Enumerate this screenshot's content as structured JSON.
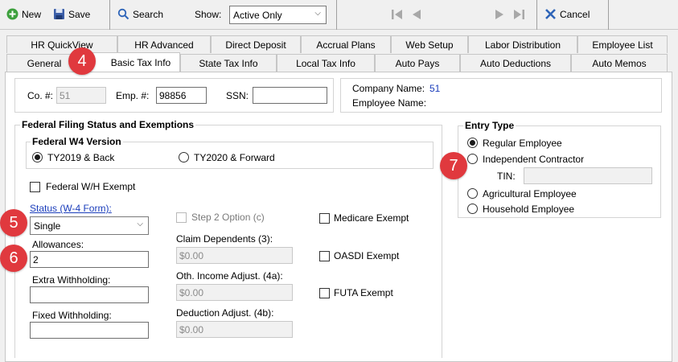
{
  "toolbar": {
    "new_label": "New",
    "save_label": "Save",
    "search_label": "Search",
    "show_label": "Show:",
    "show_value": "Active Only",
    "cancel_label": "Cancel"
  },
  "tabs_row1": [
    "HR QuickView",
    "HR Advanced",
    "Direct Deposit",
    "Accrual Plans",
    "Web Setup",
    "Labor Distribution",
    "Employee List"
  ],
  "tabs_row2": [
    "General",
    "Basic Tax Info",
    "State Tax Info",
    "Local Tax Info",
    "Auto Pays",
    "Auto Deductions",
    "Auto Memos"
  ],
  "header": {
    "co_label": "Co. #:",
    "co_value": "51",
    "emp_label": "Emp. #:",
    "emp_value": "98856",
    "ssn_label": "SSN:",
    "ssn_value": "",
    "company_name_label": "Company Name:",
    "company_name_value": "51",
    "employee_name_label": "Employee Name:",
    "employee_name_value": ""
  },
  "federal": {
    "title": "Federal Filing Status and Exemptions",
    "w4_title": "Federal W4 Version",
    "w4_opt1": "TY2019 & Back",
    "w4_opt2": "TY2020 & Forward",
    "wh_exempt": "Federal W/H Exempt",
    "status_label": "Status (W-4 Form):",
    "status_value": "Single",
    "allowances_label": "Allowances:",
    "allowances_value": "2",
    "extra_wh_label": "Extra Withholding:",
    "extra_wh_value": "",
    "fixed_wh_label": "Fixed Withholding:",
    "fixed_wh_value": "",
    "step2_label": "Step 2 Option (c)",
    "claim_dep_label": "Claim Dependents (3):",
    "claim_dep_value": "$0.00",
    "oth_income_label": "Oth. Income Adjust. (4a):",
    "oth_income_value": "$0.00",
    "deduction_label": "Deduction Adjust. (4b):",
    "deduction_value": "$0.00",
    "medicare_exempt": "Medicare Exempt",
    "oasdi_exempt": "OASDI Exempt",
    "futa_exempt": "FUTA Exempt"
  },
  "entry_type": {
    "title": "Entry Type",
    "regular": "Regular Employee",
    "independent": "Independent Contractor",
    "tin_label": "TIN:",
    "tin_value": "",
    "agricultural": "Agricultural Employee",
    "household": "Household Employee"
  },
  "callouts": {
    "c4": "4",
    "c5": "5",
    "c6": "6",
    "c7": "7"
  },
  "colors": {
    "callout": "#e0393e",
    "link": "#1a3dbb"
  }
}
